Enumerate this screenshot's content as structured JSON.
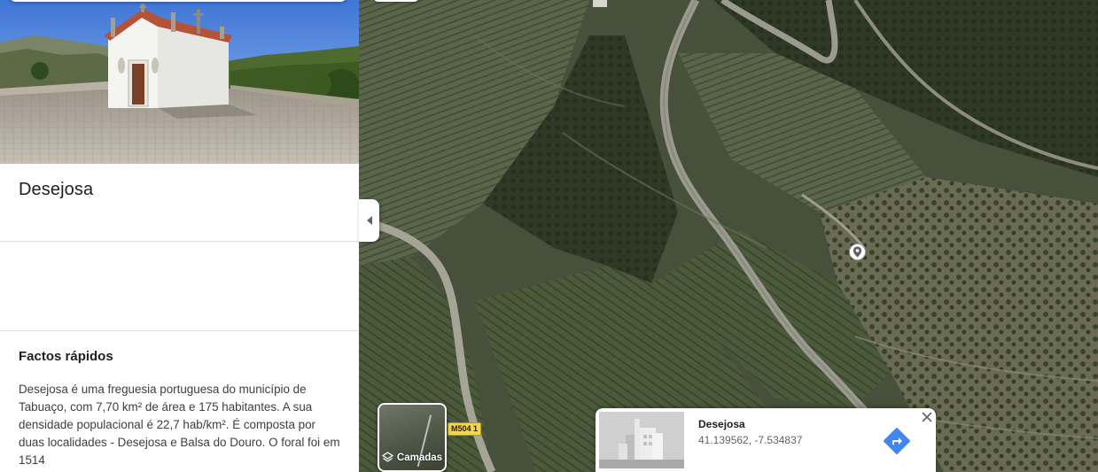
{
  "place": {
    "name": "Desejosa",
    "photo_alt": "Capela de Desejosa"
  },
  "facts": {
    "heading": "Factos rápidos",
    "text": "Desejosa é uma freguesia portuguesa do município de Tabuaço, com 7,70 km² de área e 175 habitantes. A sua densidade populacional é 22,7 hab/km². É composta por duas localidades - Desejosa e Balsa do Douro. O foral foi em 1514"
  },
  "map": {
    "layers_label": "Camadas",
    "road_label": "M504 1",
    "pin_icon": "map-pin-icon"
  },
  "info_card": {
    "title": "Desejosa",
    "coords": "41.139562, -7.534837"
  },
  "colors": {
    "accent": "#4285f4",
    "road_badge": "#f6d54a",
    "divider": "#e0e0e0"
  }
}
